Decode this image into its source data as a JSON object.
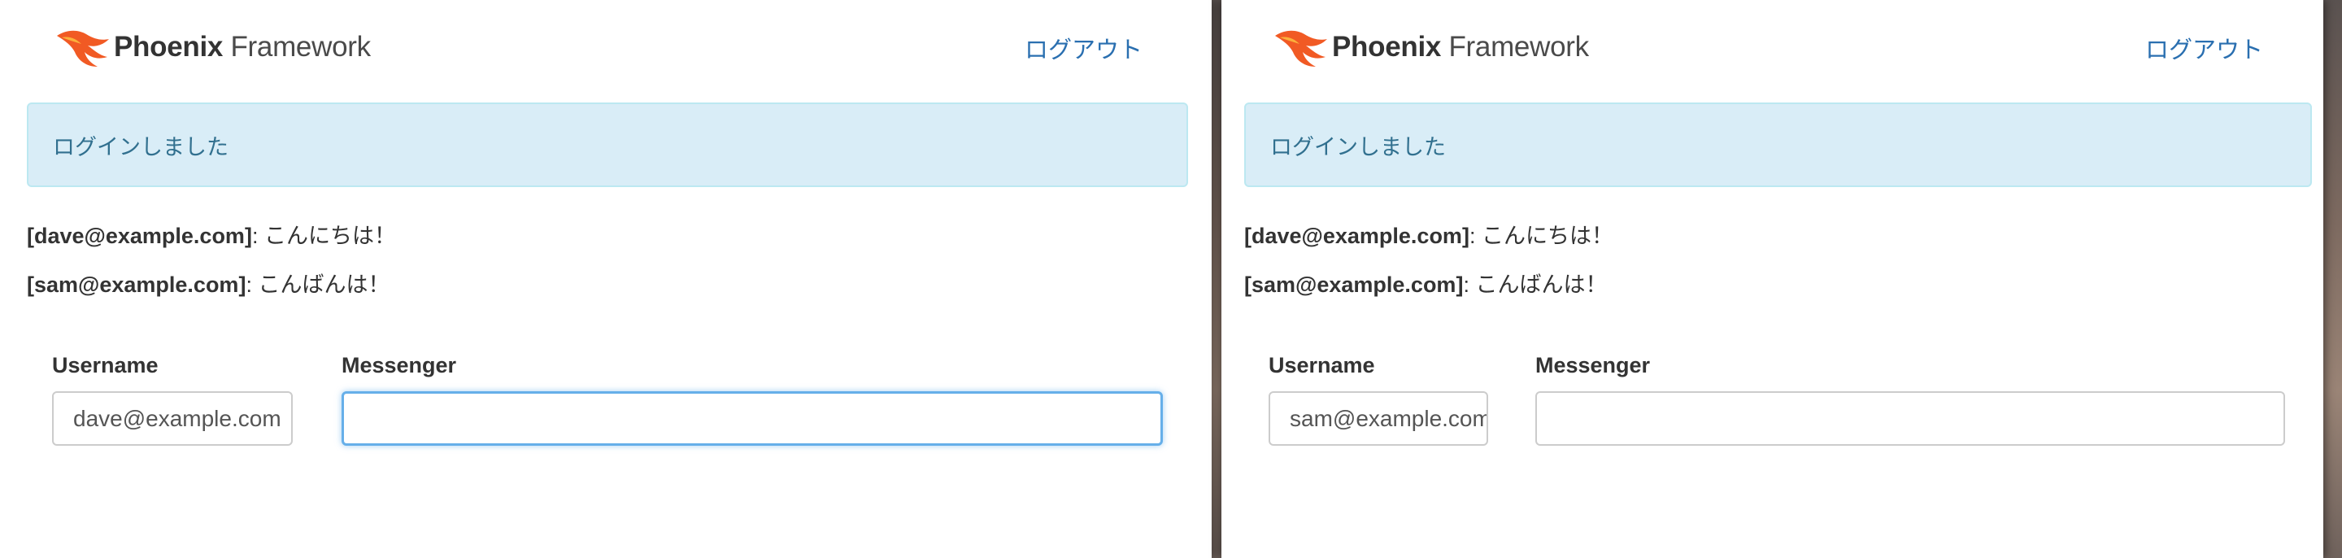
{
  "colors": {
    "accent_link": "#2a6fb0",
    "alert_bg": "#d9edf7",
    "alert_text": "#31708f",
    "logo_flame": "#f15a24",
    "focus_border": "#66afe9"
  },
  "windows": [
    {
      "logo": {
        "bold": "Phoenix",
        "regular": " Framework",
        "icon": "phoenix-flame-icon"
      },
      "logout_label": "ログアウト",
      "flash": "ログインしました",
      "messages": [
        {
          "user": "[dave@example.com]",
          "text": ": こんにちは！"
        },
        {
          "user": "[sam@example.com]",
          "text": ": こんばんは！"
        }
      ],
      "form": {
        "username_label": "Username",
        "messenger_label": "Messenger",
        "username_value": "dave@example.com",
        "messenger_value": ""
      }
    },
    {
      "logo": {
        "bold": "Phoenix",
        "regular": " Framework",
        "icon": "phoenix-flame-icon"
      },
      "logout_label": "ログアウト",
      "flash": "ログインしました",
      "messages": [
        {
          "user": "[dave@example.com]",
          "text": ": こんにちは！"
        },
        {
          "user": "[sam@example.com]",
          "text": ": こんばんは！"
        }
      ],
      "form": {
        "username_label": "Username",
        "messenger_label": "Messenger",
        "username_value": "sam@example.com",
        "messenger_value": ""
      }
    }
  ]
}
